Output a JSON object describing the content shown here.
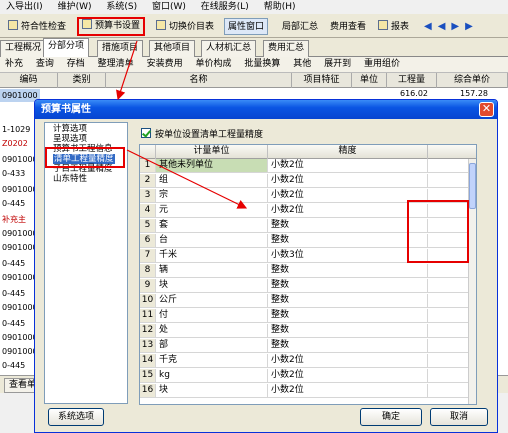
{
  "menubar": {
    "items": [
      "入导出(I)",
      "维护(W)",
      "系统(S)",
      "窗口(W)",
      "在线服务(L)",
      "帮助(H)"
    ]
  },
  "toolbar": {
    "check_label": "符合性检查",
    "budget_settings_label": "预算书设置",
    "switch_price_table_label": "切换价目表",
    "attribute_window_label": "属性窗口",
    "local_summary_label": "局部汇总",
    "fee_view_label": "费用查看",
    "report_label": "报表"
  },
  "tabs": [
    "工程概况",
    "分部分项",
    "措施项目",
    "其他项目",
    "人材机汇总",
    "费用汇总"
  ],
  "secondary_toolbar": [
    "补充",
    "查询",
    "存档",
    "整理清单",
    "安装费用",
    "单价构成",
    "批量换算",
    "其他",
    "展开到",
    "重用组价"
  ],
  "grid": {
    "headers": [
      "编码",
      "类别",
      "名称",
      "项目特征",
      "单位",
      "工程量",
      "综合单价"
    ],
    "row_codes": [
      "0901000",
      "",
      "1-1029",
      "Z0202",
      "0901000",
      "0-433",
      "0901000",
      "0-445",
      "补充主",
      "0901000",
      "0901000",
      "0-445",
      "0901000",
      "0-445",
      "0901000",
      "0-445",
      "0901000",
      "0901000",
      "0-445",
      "0-445"
    ],
    "top_row_values": [
      "616.02",
      "157.28"
    ]
  },
  "bottom_tabs": [
    "查看单"
  ],
  "dialog": {
    "title": "预算书属性",
    "tree_items": [
      "计算选项",
      "呈现选项",
      "预算书工程信息",
      "清单工程量精度",
      "子目工程量精度",
      "山东特性"
    ],
    "selected_tree_item": "清单工程量精度",
    "checkbox_label": "按单位设置清单工程量精度",
    "table_headers": [
      "计量单位",
      "精度"
    ],
    "rows": [
      {
        "n": "1",
        "unit": "其他未列单位",
        "precision": "小数2位"
      },
      {
        "n": "2",
        "unit": "组",
        "precision": "小数2位"
      },
      {
        "n": "3",
        "unit": "宗",
        "precision": "小数2位"
      },
      {
        "n": "4",
        "unit": "元",
        "precision": "小数2位"
      },
      {
        "n": "5",
        "unit": "套",
        "precision": "整数"
      },
      {
        "n": "6",
        "unit": "台",
        "precision": "整数"
      },
      {
        "n": "7",
        "unit": "千米",
        "precision": "小数3位"
      },
      {
        "n": "8",
        "unit": "辆",
        "precision": "整数"
      },
      {
        "n": "9",
        "unit": "块",
        "precision": "整数"
      },
      {
        "n": "10",
        "unit": "公斤",
        "precision": "整数"
      },
      {
        "n": "11",
        "unit": "付",
        "precision": "整数"
      },
      {
        "n": "12",
        "unit": "处",
        "precision": "整数"
      },
      {
        "n": "13",
        "unit": "部",
        "precision": "整数"
      },
      {
        "n": "14",
        "unit": "千克",
        "precision": "小数2位"
      },
      {
        "n": "15",
        "unit": "kg",
        "precision": "小数2位"
      },
      {
        "n": "16",
        "unit": "块",
        "precision": "小数2位"
      }
    ],
    "system_options_label": "系统选项",
    "ok_label": "确定",
    "cancel_label": "取消"
  },
  "colors": {
    "highlight_red": "#e60000",
    "title_blue": "#0a55e3",
    "selection_blue": "#316ac5",
    "first_row_green": "#c8ddb4"
  }
}
